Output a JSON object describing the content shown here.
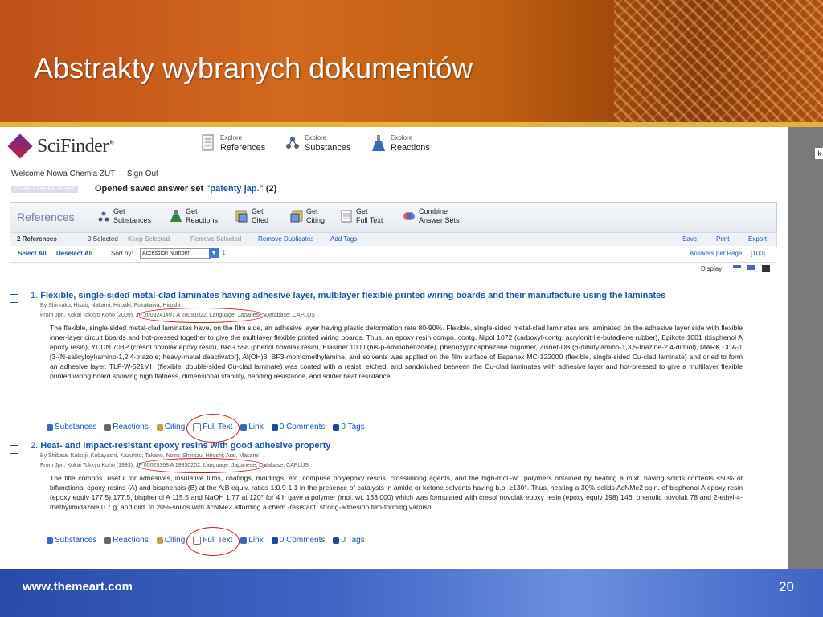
{
  "slide": {
    "title": "Abstrakty wybranych dokumentów",
    "footer_url": "www.themeart.com",
    "page_number": "20"
  },
  "app": {
    "logo": "SciFinder",
    "logo_mark": "®",
    "side_letter": "k",
    "nav": [
      {
        "small": "Explore",
        "big": "References",
        "icon": "document-icon"
      },
      {
        "small": "Explore",
        "big": "Substances",
        "icon": "molecule-icon"
      },
      {
        "small": "Explore",
        "big": "Reactions",
        "icon": "flask-icon"
      }
    ],
    "welcome": "Welcome Nowa Chemia ZUT",
    "sign_out": "Sign Out",
    "keep_me_posted": "Create Keep Me Posted",
    "opened_prefix": "Opened saved answer set",
    "opened_setname": "\"patenty jap.\"",
    "opened_count": "(2)"
  },
  "panel": {
    "title": "References",
    "tools": [
      {
        "l1": "Get",
        "l2": "Substances",
        "icon": "molecule-icon"
      },
      {
        "l1": "Get",
        "l2": "Reactions",
        "icon": "flask-icon"
      },
      {
        "l1": "Get",
        "l2": "Cited",
        "icon": "cited-icon"
      },
      {
        "l1": "Get",
        "l2": "Citing",
        "icon": "citing-icon"
      },
      {
        "l1": "Get",
        "l2": "Full Text",
        "icon": "full-text-icon"
      },
      {
        "l1": "Combine",
        "l2": "Answer Sets",
        "icon": "combine-icon"
      }
    ]
  },
  "toolbar": {
    "count": "2 References",
    "selected": "0 Selected",
    "keep_selected": "Keep Selected",
    "remove_selected": "Remove Selected",
    "remove_duplicates": "Remove Duplicates",
    "add_tags": "Add Tags",
    "save": "Save",
    "print": "Print",
    "export": "Export",
    "select_all": "Select All",
    "deselect_all": "Deselect All",
    "sort_by": "Sort by:",
    "sort_value": "Accession Number",
    "answers_per_page": "Answers per Page",
    "answers_value": "[100]",
    "display": "Display:"
  },
  "results": [
    {
      "num": "1.",
      "title": "Flexible, single-sided metal-clad laminates having adhesive layer, multilayer flexible printed wiring boards and their manufacture using the laminates",
      "by": "By Shinraku, Hisao; Nakami, Hiroaki; Fukukawa, Hiroshi",
      "from": "From Jpn. Kokai Tokkyo Koho (2009), JP 2009241491 A 20091022. Language: Japanese, Database: CAPLUS",
      "abstract": "The flexible, single-sided metal-clad laminates have, on the film side, an adhesive layer having plastic deformation rate 80-90%.  Flexible, single-sided metal-clad laminates are laminated on the adhesive layer side with flexible inner-layer circuit boards and hot-pressed together to give the multilayer flexible printed wiring boards.  Thus, an epoxy resin compn. contg. Nipol 1072 (carboxyl-contg. acrylonitrile-butadiene rubber), Epikote 1001 (bisphenol A epoxy resin), YDCN 703P (cresol novolak epoxy resin), BRG 558 (phenol novolak resin), Elasmer 1000 (bis-p-aminobenzoate), phenoxyphosphazene oligomer, Zisnet-DB (6-dibutylamino-1,3,5-triazine-2,4-dithiol), MARK CDA-1 [3-(N-salicyloyl)amino-1,2,4-triazole; heavy-metal deactivator], Al(OH)3, BF3-momomethylamine, and solvents was applied on the film surface of Espanex MC-122000 (flexible, single-sided Cu-clad laminate) and dried to form an adhesive layer.  TLF-W-521MH (flexible, double-sided Cu-clad laminate) was coated with a resist, etched, and sandwiched between the Cu-clad laminates with adhesive layer and hot-pressed to give a multilayer flexible printed wiring board showing high flatness, dimensional stability, bending resistance, and solder heat resistance.",
      "links": [
        "Substances",
        "Reactions",
        "Citing",
        "Full Text",
        "Link",
        "0 Comments",
        "0 Tags"
      ]
    },
    {
      "num": "2.",
      "title": "Heat- and impact-resistant epoxy resins with good adhesive property",
      "by": "By Shibata, Katsuji; Kobayashi, Kazuhito; Takano, Nozu; Shimizu, Hiroshi; Arai, Masami",
      "from": "From Jpn. Kokai Tokkyo Koho (1993), JP 05025368 A 19930202. Language: Japanese, Database: CAPLUS",
      "abstract": "The title compns. useful for adhesives, insulative films, coatings, moldings, etc. comprise polyepoxy resins, crosslinking agents, and the high-mol.-wt. polymers obtained by heating a mixt. having solids contents ≤50% of bifunctional epoxy resins (A) and bisphenols (B) at the A:B equiv. ratios 1:0.9-1.1 in the presence of catalysts in amide or ketone solvents having b.p. ≥130°.  Thus, heating a 30%-solids AcNMe2 soln. of bisphenol A epoxy resin (epoxy equiv 177.5) 177.5, bisphenol A 115.5 and NaOH 1.77 at 120° for 4 h gave a polymer (mol. wt. 133,000) which was formulated with cresol novolak epoxy resin (epoxy equiv 198) 146, phenolic novolak 78 and 2-ethyl-4-methylimidazole 0.7 g, and dild. to 20%-solids with AcNMe2 affording a chem.-resistant, strong-adhesion film-forming varnish.",
      "links": [
        "Substances",
        "Reactions",
        "Citing",
        "Full Text",
        "Link",
        "0 Comments",
        "0 Tags"
      ]
    }
  ],
  "colors": {
    "link": "#1a55b0",
    "highlight_oval": "#c02020",
    "header_orange": "#c0501a",
    "footer_blue": "#3f64c4"
  }
}
